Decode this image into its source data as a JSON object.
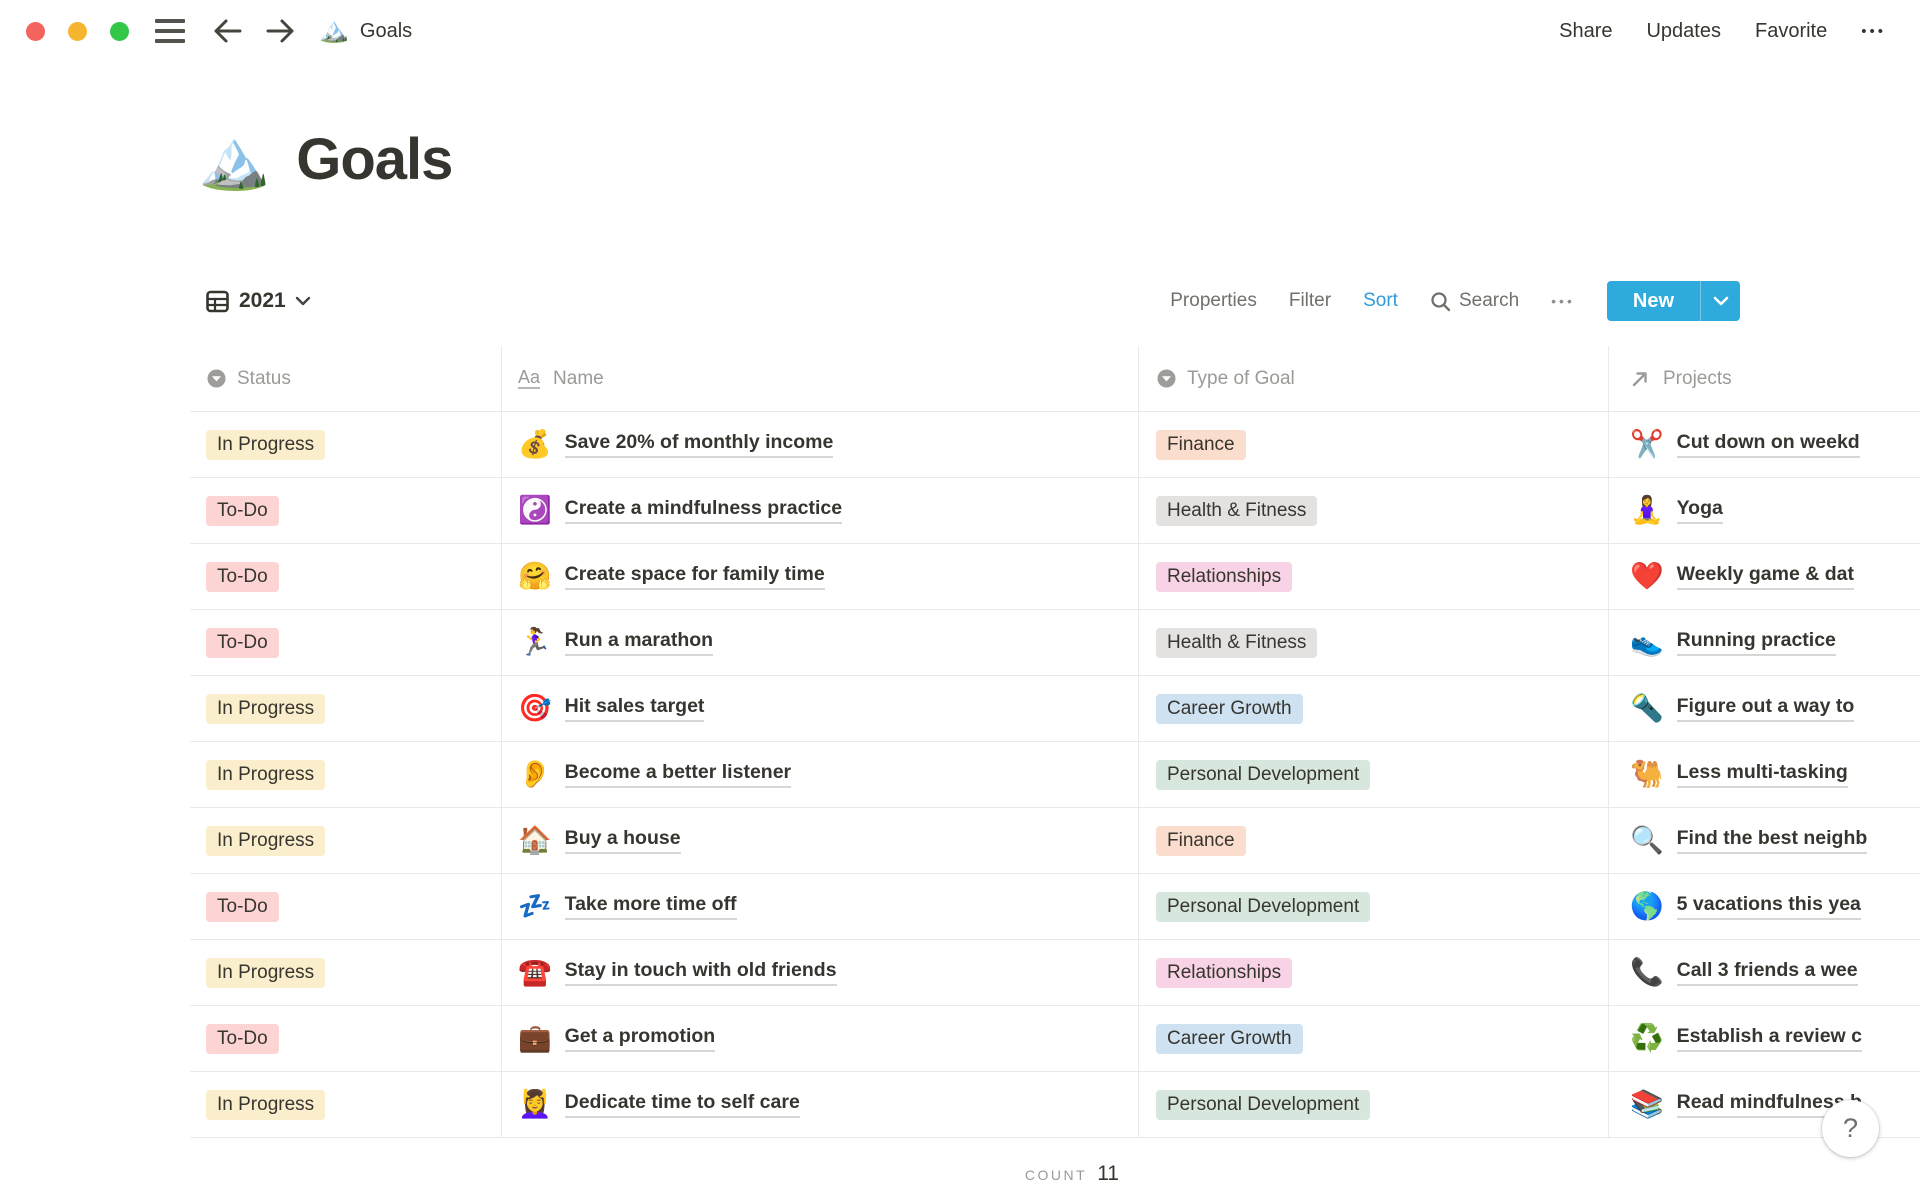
{
  "topbar": {
    "breadcrumb": {
      "icon": "🏔️",
      "title": "Goals"
    },
    "menu": {
      "share": "Share",
      "updates": "Updates",
      "favorite": "Favorite",
      "more_icon": "•••"
    }
  },
  "page": {
    "icon": "🏔️",
    "title": "Goals"
  },
  "toolbar": {
    "view_name": "2021",
    "properties": "Properties",
    "filter": "Filter",
    "sort": "Sort",
    "search": "Search",
    "more_icon": "•••",
    "new_label": "New"
  },
  "colors": {
    "accent_blue": "#2EAADC",
    "sort_active_blue": "#2D9CDB",
    "text": "#37352F",
    "muted_gray": "#9B9A97",
    "row_border": "#E9E9E7"
  },
  "table": {
    "columns": [
      {
        "label": "Status",
        "icon": "select-icon"
      },
      {
        "label": "Name",
        "icon": "text-icon"
      },
      {
        "label": "Type of Goal",
        "icon": "select-icon"
      },
      {
        "label": "Projects",
        "icon": "relation-icon"
      }
    ],
    "text_icon_glyph": "Aa",
    "palette": {
      "In Progress": "#FBEECC",
      "To-Do": "#FCD4D4",
      "Finance": "#FBDDCE",
      "Health & Fitness": "#E3E2E0",
      "Relationships": "#F8D3E5",
      "Career Growth": "#CEE2F2",
      "Personal Development": "#D7E7DE"
    },
    "rows": [
      {
        "status": "In Progress",
        "name_emoji": "💰",
        "name": "Save 20% of monthly income",
        "type": "Finance",
        "project_emoji": "✂️",
        "project": "Cut down on weekd"
      },
      {
        "status": "To-Do",
        "name_emoji": "☯️",
        "name": "Create a mindfulness practice",
        "type": "Health & Fitness",
        "project_emoji": "🧘‍♀️",
        "project": "Yoga"
      },
      {
        "status": "To-Do",
        "name_emoji": "🤗",
        "name": "Create space for family time",
        "type": "Relationships",
        "project_emoji": "❤️",
        "project": "Weekly game & dat"
      },
      {
        "status": "To-Do",
        "name_emoji": "🏃‍♀️",
        "name": "Run a marathon",
        "type": "Health & Fitness",
        "project_emoji": "👟",
        "project": "Running practice"
      },
      {
        "status": "In Progress",
        "name_emoji": "🎯",
        "name": "Hit sales target",
        "type": "Career Growth",
        "project_emoji": "🔦",
        "project": "Figure out a way to"
      },
      {
        "status": "In Progress",
        "name_emoji": "👂",
        "name": "Become a better listener",
        "type": "Personal Development",
        "project_emoji": "🐫",
        "project": "Less multi-tasking"
      },
      {
        "status": "In Progress",
        "name_emoji": "🏠",
        "name": "Buy a house",
        "type": "Finance",
        "project_emoji": "🔍",
        "project": "Find the best neighb"
      },
      {
        "status": "To-Do",
        "name_emoji": "💤",
        "name": "Take more time off",
        "type": "Personal Development",
        "project_emoji": "🌎",
        "project": "5 vacations this yea"
      },
      {
        "status": "In Progress",
        "name_emoji": "☎️",
        "name": "Stay in touch with old friends",
        "type": "Relationships",
        "project_emoji": "📞",
        "project": "Call 3 friends a wee"
      },
      {
        "status": "To-Do",
        "name_emoji": "💼",
        "name": "Get a promotion",
        "type": "Career Growth",
        "project_emoji": "♻️",
        "project": "Establish a review c"
      },
      {
        "status": "In Progress",
        "name_emoji": "💆‍♀️",
        "name": "Dedicate time to self care",
        "type": "Personal Development",
        "project_emoji": "📚",
        "project": "Read mindfulness b"
      }
    ],
    "footer": {
      "count_label": "COUNT",
      "count_value": "11"
    }
  },
  "help_button": {
    "glyph": "?"
  }
}
